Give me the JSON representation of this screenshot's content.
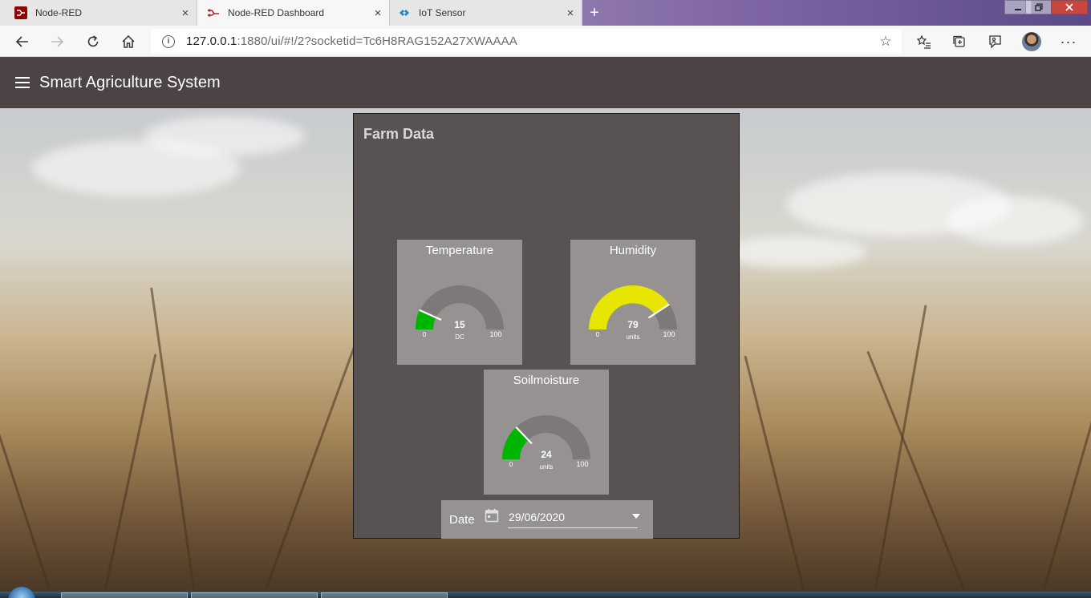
{
  "browser": {
    "tabs": [
      {
        "title": "Node-RED",
        "icon": "node-red-icon",
        "active": false
      },
      {
        "title": "Node-RED Dashboard",
        "icon": "node-red-dashboard-icon",
        "active": true
      },
      {
        "title": "IoT Sensor",
        "icon": "iot-sensor-icon",
        "active": false
      }
    ],
    "close_glyph": "×",
    "new_tab_glyph": "+",
    "url_host": "127.0.0.1",
    "url_rest": ":1880/ui/#!/2?socketid=Tc6H8RAG152A27XWAAAA"
  },
  "app": {
    "title": "Smart Agriculture System"
  },
  "group": {
    "title": "Farm Data"
  },
  "gauges": {
    "temperature": {
      "title": "Temperature",
      "value": "15",
      "units": "DC",
      "min": "0",
      "max": "100",
      "fill_color": "#00b500"
    },
    "humidity": {
      "title": "Humidity",
      "value": "79",
      "units": "units",
      "min": "0",
      "max": "100",
      "fill_color": "#e6e600"
    },
    "soilmoisture": {
      "title": "Soilmoisture",
      "value": "24",
      "units": "units",
      "min": "0",
      "max": "100",
      "fill_color": "#00b500"
    }
  },
  "date_picker": {
    "label": "Date",
    "value": "29/06/2020"
  },
  "colors": {
    "header": "#4c4444",
    "group_bg": "#585252",
    "card_bg": "#969292",
    "gauge_track": "#7d7979"
  }
}
